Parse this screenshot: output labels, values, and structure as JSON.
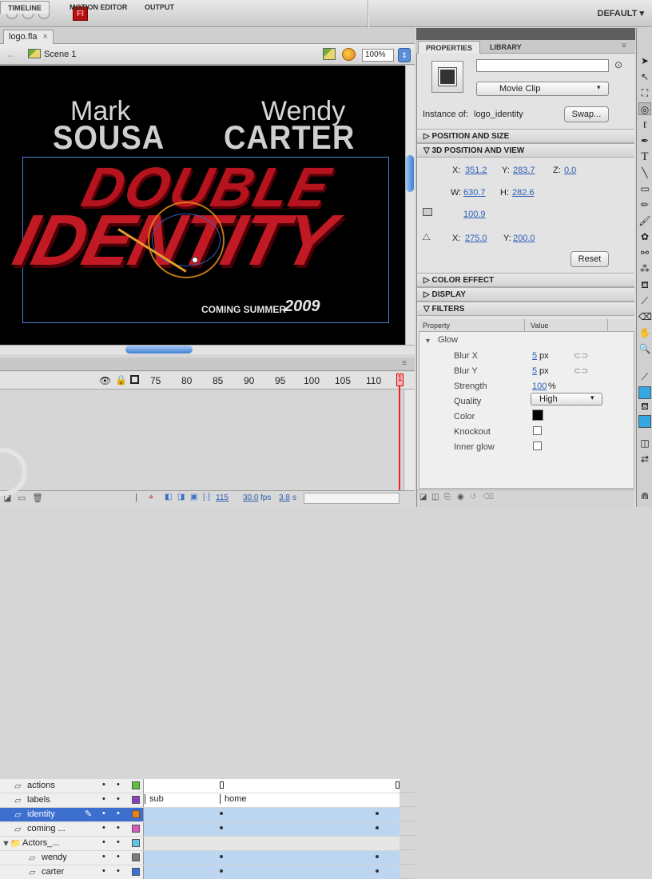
{
  "app": {
    "logo_text": "Fl",
    "workspace": "DEFAULT ▾"
  },
  "document": {
    "tab_name": "logo.fla",
    "tab_close": "×",
    "scene": "Scene 1",
    "zoom": "100%"
  },
  "stage": {
    "name1_first": "Mark",
    "name1_last": "SOUSA",
    "name2_first": "Wendy",
    "name2_last": "CARTER",
    "title_line1": "DOUBLE",
    "title_line2": "IDENTITY",
    "tagline": "COMING SUMMER",
    "year": "2009"
  },
  "timeline": {
    "tabs": [
      "TIMELINE",
      "MOTION EDITOR",
      "OUTPUT"
    ],
    "frame_numbers": [
      "75",
      "80",
      "85",
      "90",
      "95",
      "100",
      "105",
      "110"
    ],
    "playhead_frame": "1",
    "layers": [
      {
        "name": "actions",
        "color": "#59c23a",
        "tween": false,
        "label": ""
      },
      {
        "name": "labels",
        "color": "#8a3fbf",
        "tween": false,
        "label": "sub",
        "label2": "home"
      },
      {
        "name": "identity",
        "color": "#e8801c",
        "tween": true,
        "label": ""
      },
      {
        "name": "coming ...",
        "color": "#d957c0",
        "tween": true,
        "label": ""
      },
      {
        "name": "Actors_...",
        "color": "#5fc6e6",
        "tween": false,
        "label": "",
        "folder": true
      },
      {
        "name": "wendy",
        "color": "#7b7b7b",
        "tween": true,
        "label": ""
      },
      {
        "name": "carter",
        "color": "#3b6fd6",
        "tween": true,
        "label": ""
      }
    ],
    "footer": {
      "frame": "115",
      "fps": "30.0",
      "fps_unit": "fps",
      "time": "3.8",
      "time_unit": "s"
    }
  },
  "properties": {
    "tabs": [
      "PROPERTIES",
      "LIBRARY"
    ],
    "instance_name": "",
    "symbol_type": "Movie Clip",
    "instance_of_label": "Instance of:",
    "instance_of": "logo_identity",
    "swap": "Swap...",
    "sections": {
      "pos_size": "POSITION AND SIZE",
      "pos_3d": "3D POSITION AND VIEW",
      "color": "COLOR EFFECT",
      "display": "DISPLAY",
      "filters": "FILTERS"
    },
    "x": "351.2",
    "y": "283.7",
    "z": "0.0",
    "w": "630.7",
    "h": "282.6",
    "perspective": "100.9",
    "vp_x": "275.0",
    "vp_y": "200.0",
    "reset": "Reset",
    "filters": {
      "col_property": "Property",
      "col_value": "Value",
      "name": "Glow",
      "blur_x": "5",
      "blur_y": "5",
      "blur_unit": "px",
      "strength": "100",
      "strength_unit": "%",
      "quality": "High",
      "rows": [
        "Blur X",
        "Blur Y",
        "Strength",
        "Quality",
        "Color",
        "Knockout",
        "Inner glow"
      ]
    }
  }
}
